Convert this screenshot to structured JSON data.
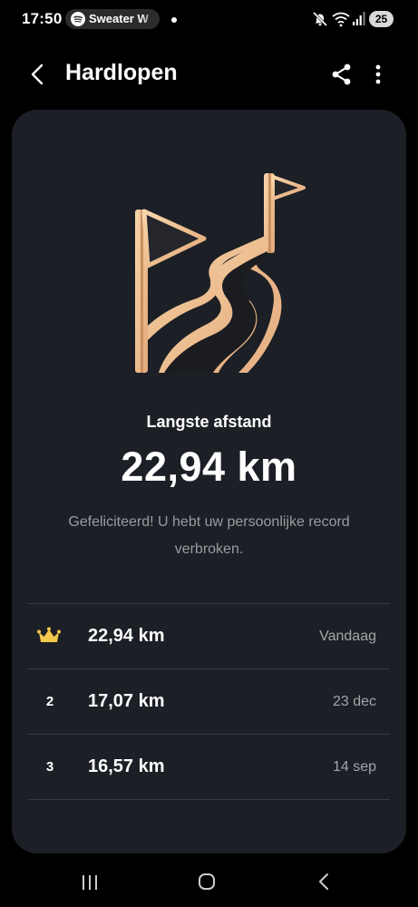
{
  "status_bar": {
    "time": "17:50",
    "media_pill_text": "Sweater W",
    "battery": "25",
    "icons": [
      "spotify-icon",
      "notification-dot",
      "mute-icon",
      "wifi-icon",
      "signal-icon",
      "battery-icon"
    ]
  },
  "header": {
    "title": "Hardlopen",
    "icons": [
      "back-arrow-icon",
      "share-icon",
      "more-vertical-icon"
    ]
  },
  "achievement": {
    "icon": "road-flags-icon",
    "label": "Langste afstand",
    "value": "22,94 km",
    "message": "Gefeliciteerd! U hebt uw persoonlijke record verbroken."
  },
  "records": [
    {
      "rank": "",
      "rank_icon": "crown-icon",
      "value": "22,94 km",
      "date": "Vandaag"
    },
    {
      "rank": "2",
      "value": "17,07 km",
      "date": "23 dec"
    },
    {
      "rank": "3",
      "value": "16,57 km",
      "date": "14 sep"
    }
  ],
  "colors": {
    "background": "#000000",
    "card": "#1c1f25",
    "accent_gold": "#f5c99a",
    "crown": "#f3c74b",
    "muted_text": "#9a9ca0"
  },
  "nav_bar": {
    "icons": [
      "recent-apps-icon",
      "home-icon",
      "back-icon"
    ]
  }
}
